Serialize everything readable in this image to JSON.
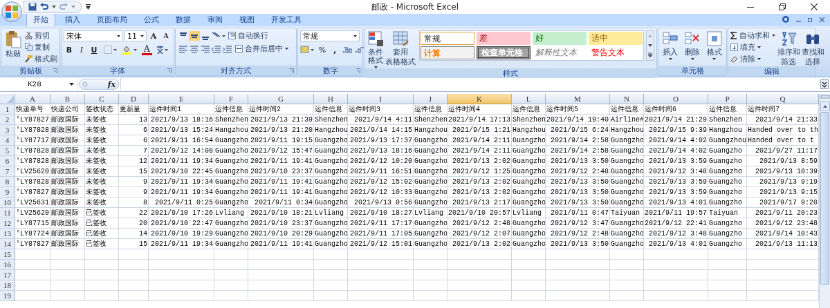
{
  "window": {
    "title": "邮政 - Microsoft Excel"
  },
  "tabs": [
    {
      "label": "开始",
      "selected": true
    },
    {
      "label": "插入",
      "selected": false
    },
    {
      "label": "页面布局",
      "selected": false
    },
    {
      "label": "公式",
      "selected": false
    },
    {
      "label": "数据",
      "selected": false
    },
    {
      "label": "审阅",
      "selected": false
    },
    {
      "label": "视图",
      "selected": false
    },
    {
      "label": "开发工具",
      "selected": false
    }
  ],
  "ribbon": {
    "clipboard": {
      "label": "剪贴板",
      "paste": "粘贴",
      "items": [
        "剪切",
        "复制",
        "格式刷"
      ]
    },
    "font": {
      "label": "字体",
      "name": "宋体",
      "size": "11",
      "grow": "A",
      "shrink": "A",
      "bold": "B",
      "italic": "I",
      "underline": "U",
      "color_letter": "A"
    },
    "alignment": {
      "label": "对齐方式",
      "wrap": "自动换行",
      "merge": "合并后居中"
    },
    "number": {
      "label": "数字",
      "format": "常规",
      "percent": "%",
      "comma": ","
    },
    "styles": {
      "label": "样式",
      "conditional": "条件格式",
      "table": [
        "套用",
        "表格格式"
      ],
      "presets": [
        {
          "label": "常规",
          "kind": "normal"
        },
        {
          "label": "差",
          "kind": "bad"
        },
        {
          "label": "好",
          "kind": "good"
        },
        {
          "label": "适中",
          "kind": "neutral"
        },
        {
          "label": "计算",
          "kind": "calculation"
        },
        {
          "label": "检查单元格",
          "kind": "check"
        },
        {
          "label": "解释性文本",
          "kind": "explanatory"
        },
        {
          "label": "警告文本",
          "kind": "warning"
        }
      ]
    },
    "cells": {
      "label": "单元格",
      "items": [
        "插入",
        "删除",
        "格式"
      ]
    },
    "editing": {
      "label": "编辑",
      "small": [
        "自动求和",
        "填充",
        "清除"
      ],
      "large": [
        [
          "排序和",
          "筛选"
        ],
        [
          "查找和",
          "选择"
        ]
      ]
    }
  },
  "formula_bar": {
    "name_box": "K28",
    "fx": "fx"
  },
  "sheet": {
    "columns": [
      {
        "letter": "A",
        "selected": false,
        "kind": "text"
      },
      {
        "letter": "B",
        "selected": false,
        "kind": "text"
      },
      {
        "letter": "C",
        "selected": false,
        "kind": "text"
      },
      {
        "letter": "D",
        "selected": false,
        "kind": "number"
      },
      {
        "letter": "E",
        "selected": false,
        "kind": "number"
      },
      {
        "letter": "F",
        "selected": false,
        "kind": "text"
      },
      {
        "letter": "G",
        "selected": false,
        "kind": "number"
      },
      {
        "letter": "H",
        "selected": false,
        "kind": "text"
      },
      {
        "letter": "I",
        "selected": false,
        "kind": "number"
      },
      {
        "letter": "J",
        "selected": false,
        "kind": "text"
      },
      {
        "letter": "K",
        "selected": true,
        "kind": "number"
      },
      {
        "letter": "L",
        "selected": false,
        "kind": "text"
      },
      {
        "letter": "M",
        "selected": false,
        "kind": "number"
      },
      {
        "letter": "N",
        "selected": false,
        "kind": "text"
      },
      {
        "letter": "O",
        "selected": false,
        "kind": "number"
      },
      {
        "letter": "P",
        "selected": false,
        "kind": "text"
      },
      {
        "letter": "Q",
        "selected": false,
        "kind": "number"
      }
    ],
    "rows": [
      {
        "number": "1",
        "kind": "header",
        "cells": [
          "快递单号",
          "快递公司",
          "签收状态",
          "更新量",
          "运件时间1",
          "运件信息",
          "运件时间2",
          "运件信息",
          "运件时间3",
          "运件信息",
          "运件时间4",
          "运件信息",
          "运件时间5",
          "运件信息",
          "运件时间6",
          "运件信息",
          "运件时间7"
        ]
      },
      {
        "number": "2",
        "cells": [
          "'LY87827",
          "邮政国际",
          "未签收",
          "13",
          "2021/9/13 18:16",
          "Shenzhen",
          "2021/9/13 21:39",
          "Shenzhen",
          "2021/9/14 4:11",
          "Shenzhen",
          "2021/9/14 17:13",
          "Shenzhen",
          "2021/9/14 19:40",
          "Airline#",
          "2021/9/14 21:29",
          "Shenzhen",
          "2021/9/14 21:33"
        ]
      },
      {
        "number": "3",
        "cells": [
          "'LY87828",
          "邮政国际",
          "未签收",
          "6",
          "2021/9/13 15:24",
          "Hangzhou",
          "2021/9/13 21:20",
          "Hangzhou",
          "2021/9/14 14:15",
          "Hangzhou",
          "2021/9/15 1:21",
          "Hangzhou",
          "2021/9/15 6:24",
          "Hangzhou",
          "2021/9/15 9:39",
          "Hangzhou",
          {
            "text": "Handed over to th",
            "kind": "text"
          }
        ]
      },
      {
        "number": "4",
        "cells": [
          "'LY87717",
          "邮政国际",
          "未签收",
          "6",
          "2021/9/11 16:54",
          "Guangzho",
          "2021/9/11 19:15",
          "Guangzho",
          "2021/9/13 17:37",
          "Guangzho",
          "2021/9/14 2:11",
          "Guangzho",
          "2021/9/14 2:58",
          "Guangzho",
          "2021/9/14 4:02",
          "Guangzhou",
          {
            "text": "Handed over to t",
            "kind": "text"
          }
        ]
      },
      {
        "number": "5",
        "cells": [
          "'LY87828",
          "邮政国际",
          "未签收",
          "7",
          "2021/9/12 14:08",
          "Guangzho",
          "2021/9/12 15:47",
          "Guangzho",
          "2021/9/13 18:16",
          "Guangzho",
          "2021/9/14 2:11",
          "Guangzho",
          "2021/9/14 2:58",
          "Guangzho",
          "2021/9/14 4:02",
          "Guangzho",
          "2021/9/27 11:17"
        ]
      },
      {
        "number": "6",
        "cells": [
          "'LY87828",
          "邮政国际",
          "未签收",
          "12",
          "2021/9/11 19:34",
          "Guangzho",
          "2021/9/11 19:41",
          "Guangzho",
          "2021/9/12 10:20",
          "Guangzho",
          "2021/9/13 2:02",
          "Guangzho",
          "2021/9/13 3:50",
          "Guangzho",
          "2021/9/13 3:59",
          "Guangzho",
          "2021/9/13 8:59"
        ]
      },
      {
        "number": "7",
        "cells": [
          "'LV25620",
          "邮政国际",
          "未签收",
          "15",
          "2021/9/10 22:45",
          "Guangzho",
          "2021/9/10 23:37",
          "Guangzho",
          "2021/9/11 16:51",
          "Guangzho",
          "2021/9/12 1:25",
          "Guangzho",
          "2021/9/12 2:48",
          "Guangzho",
          "2021/9/12 3:48",
          "Guangzho",
          "2021/9/13 10:39"
        ]
      },
      {
        "number": "8",
        "cells": [
          "'LY87828",
          "邮政国际",
          "未签收",
          "9",
          "2021/9/11 19:34",
          "Guangzho",
          "2021/9/11 19:41",
          "Guangzho",
          "2021/9/12 15:02",
          "Guangzho",
          "2021/9/13 2:02",
          "Guangzho",
          "2021/9/13 3:50",
          "Guangzho",
          "2021/9/13 3:59",
          "Guangzho",
          "2021/9/13 9:19"
        ]
      },
      {
        "number": "9",
        "cells": [
          "'LY87827",
          "邮政国际",
          "未签收",
          "9",
          "2021/9/11 19:34",
          "Guangzho",
          "2021/9/11 19:41",
          "Guangzho",
          "2021/9/12 10:33",
          "Guangzho",
          "2021/9/13 2:02",
          "Guangzho",
          "2021/9/13 3:50",
          "Guangzho",
          "2021/9/13 3:59",
          "Guangzho",
          "2021/9/13 9:15"
        ]
      },
      {
        "number": "10",
        "cells": [
          "'LV25631",
          "邮政国际",
          "未签收",
          "8",
          "2021/9/11 0:25",
          "Guangzho",
          "2021/9/11 0:34",
          "Guangzho",
          "2021/9/13 0:56",
          "Guangzho",
          "2021/9/13 2:17",
          "Guangzho",
          "2021/9/13 3:50",
          "Guangzho",
          "2021/9/13 4:01",
          "Guangzho",
          "2021/9/17 9:20"
        ]
      },
      {
        "number": "11",
        "cells": [
          "'LV25620",
          "邮政国际",
          "已签收",
          "22",
          "2021/9/10 17:26",
          "Lvliang",
          "2021/9/10 18:21",
          "Lvliang",
          "2021/9/10 18:27",
          "Lvliang",
          "2021/9/10 20:57",
          "Lvliang",
          "2021/9/11 0:47",
          "Taiyuan",
          "2021/9/11 19:57",
          "Taiyuan",
          "2021/9/11 20:23"
        ]
      },
      {
        "number": "12",
        "cells": [
          "'LY87715",
          "邮政国际",
          "已签收",
          "20",
          "2021/9/10 22:47",
          "Guangzho",
          "2021/9/10 23:37",
          "Guangzho",
          "2021/9/11 17:17",
          "Guangzho",
          "2021/9/12 2:48",
          "Guangzho",
          "2021/9/12 3:47",
          "Guangzho",
          "2021/9/12 22:41",
          "Guangzho",
          "2021/9/12 23:48"
        ]
      },
      {
        "number": "13",
        "cells": [
          "'LY87724",
          "邮政国际",
          "已签收",
          "14",
          "2021/9/10 19:29",
          "Guangzho",
          "2021/9/10 20:29",
          "Guangzho",
          "2021/9/11 17:05",
          "Guangzho",
          "2021/9/12 2:07",
          "Guangzho",
          "2021/9/12 2:48",
          "Guangzho",
          "2021/9/12 3:48",
          "Guangzho",
          "2021/9/14 10:43"
        ]
      },
      {
        "number": "14",
        "cells": [
          "'LY87827",
          "邮政国际",
          "已签收",
          "15",
          "2021/9/11 19:34",
          "Guangzho",
          "2021/9/11 19:41",
          "Guangzho",
          "2021/9/12 15:01",
          "Guangzho",
          "2021/9/13 2:02",
          "Guangzho",
          "2021/9/13 3:50",
          "Guangzho",
          "2021/9/13 4:01",
          "Guangzho",
          "2021/9/13 11:13"
        ]
      },
      {
        "number": "15"
      },
      {
        "number": "16"
      },
      {
        "number": "17"
      },
      {
        "number": "18"
      },
      {
        "number": "19"
      }
    ]
  }
}
